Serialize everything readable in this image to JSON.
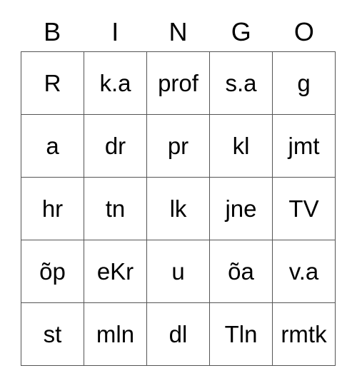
{
  "card": {
    "headers": [
      "B",
      "I",
      "N",
      "G",
      "O"
    ],
    "rows": [
      [
        "R",
        "k.a",
        "prof",
        "s.a",
        "g"
      ],
      [
        "a",
        "dr",
        "pr",
        "kl",
        "jmt"
      ],
      [
        "hr",
        "tn",
        "lk",
        "jne",
        "TV"
      ],
      [
        "õp",
        "eKr",
        "u",
        "õa",
        "v.a"
      ],
      [
        "st",
        "mln",
        "dl",
        "Tln",
        "rmtk"
      ]
    ]
  },
  "colors": {
    "background": "#ffffff",
    "text": "#000000",
    "grid_line": "#555555"
  }
}
